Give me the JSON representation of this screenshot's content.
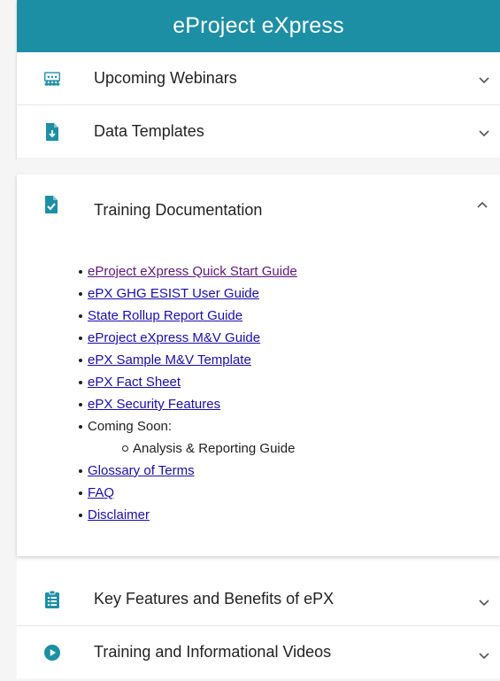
{
  "header": {
    "title": "eProject eXpress"
  },
  "accordion_top": [
    {
      "label": "Upcoming Webinars",
      "icon": "webinar-icon"
    },
    {
      "label": "Data Templates",
      "icon": "file-download-icon"
    }
  ],
  "training": {
    "label": "Training Documentation",
    "icon": "file-check-icon",
    "links": [
      {
        "text": "eProject eXpress Quick Start Guide",
        "visited": true
      },
      {
        "text": "ePX GHG ESIST User Guide"
      },
      {
        "text": "State Rollup Report Guide"
      },
      {
        "text": "eProject eXpress M&V Guide"
      },
      {
        "text": "ePX Sample M&V Template"
      },
      {
        "text": "ePX Fact Sheet"
      },
      {
        "text": "ePX Security Features"
      }
    ],
    "coming_soon": {
      "label": "Coming Soon:",
      "items": [
        "Analysis & Reporting Guide"
      ]
    },
    "links_after": [
      {
        "text": "Glossary of Terms"
      },
      {
        "text": "FAQ"
      },
      {
        "text": "Disclaimer"
      }
    ]
  },
  "accordion_bottom": [
    {
      "label": "Key Features and Benefits of ePX",
      "icon": "clipboard-list-icon"
    },
    {
      "label": "Training and Informational Videos",
      "icon": "play-circle-icon"
    }
  ],
  "colors": {
    "accent": "#1d8fa5",
    "link": "#1a0dab",
    "link_visited": "#60157e"
  }
}
